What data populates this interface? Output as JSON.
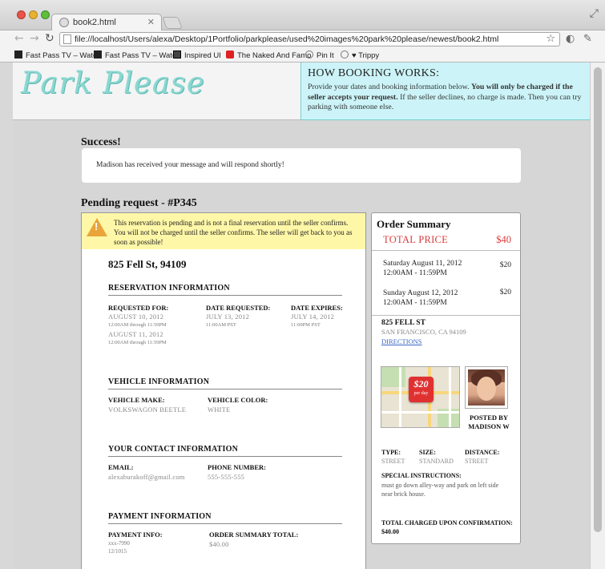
{
  "browser": {
    "tab_title": "book2.html",
    "url": "file://localhost/Users/alexa/Desktop/1Portfolio/parkplease/used%20images%20park%20please/newest/book2.html",
    "bookmarks": [
      "Fast Pass TV – Watch",
      "Fast Pass TV – Watch",
      "Inspired UI",
      "The Naked And Famo",
      "Pin It",
      "♥ Trippy"
    ]
  },
  "header": {
    "logo": "Park Please",
    "how_title": "HOW BOOKING WORKS:",
    "how_text_1": "Provide your dates and booking information below. ",
    "how_text_bold": "You will only be charged if the seller accepts your request.",
    "how_text_2": " If the seller declines, no charge is made. Then you can try parking with someone else."
  },
  "success": {
    "title": "Success!",
    "message": "Madison has received your message and will respond shortly!"
  },
  "pending": {
    "title": "Pending request - #P345",
    "warning": "This reservation is pending and is not a final reservation until the seller confirms. You will not be charged until the seller confirms. The seller will get back to you as soon as possible!",
    "address": "825 Fell St, 94109",
    "reservation": {
      "heading": "RESERVATION INFORMATION",
      "requested_for_label": "REQUESTED FOR:",
      "date1": "AUGUST 10, 2012",
      "time1": "12:00AM through 11:59PM",
      "date2": "AUGUST 11, 2012",
      "time2": "12:00AM through 11:59PM",
      "date_requested_label": "DATE REQUESTED:",
      "date_requested": "JULY 13, 2012",
      "date_requested_time": "11:00AM PST",
      "date_expires_label": "DATE EXPIRES:",
      "date_expires": "JULY 14, 2012",
      "date_expires_time": "11:00PM PST"
    },
    "vehicle": {
      "heading": "VEHICLE INFORMATION",
      "make_label": "VEHICLE MAKE:",
      "make": "VOLKSWAGON BEETLE",
      "color_label": "VEHICLE COLOR:",
      "color": "WHITE"
    },
    "contact": {
      "heading": "YOUR CONTACT INFORMATION",
      "email_label": "EMAIL:",
      "email": "alexaburakoff@gmail.com",
      "phone_label": "PHONE NUMBER:",
      "phone": "555-555-555"
    },
    "payment": {
      "heading": "PAYMENT INFORMATION",
      "info_label": "PAYMENT INFO:",
      "card": "xxx-7990",
      "expiry": "12/1015",
      "total_label": "ORDER SUMMARY TOTAL:",
      "total": "$40.00"
    }
  },
  "summary": {
    "title": "Order Summary",
    "total_label": "TOTAL PRICE",
    "total": "$40",
    "days": [
      {
        "date": "Saturday August 11, 2012",
        "time": "12:00AM - 11:59PM",
        "price": "$20"
      },
      {
        "date": "Sunday August 12, 2012",
        "time": "12:00AM - 11:59PM",
        "price": "$20"
      }
    ],
    "street": "825 FELL ST",
    "city": "SAN FRANCISCO, CA 94109",
    "directions": "DIRECTIONS",
    "price_tag": "$20",
    "price_tag_sub": "per day",
    "posted_by": "POSTED BY MADISON W",
    "type_label": "TYPE:",
    "type": "STREET",
    "size_label": "SIZE:",
    "size": "STANDARD",
    "distance_label": "DISTANCE:",
    "distance": "STREET",
    "instructions_label": "SPECIAL INSTRUCTIONS:",
    "instructions": "must go down alley-way and park on left side near brick house.",
    "charged": "TOTAL CHARGED UPON CONFIRMATION: $40.00"
  },
  "colors": {
    "accent_red": "#d93c3c",
    "info_box": "#ccf4f8",
    "warning_bg": "#fff7a8",
    "logo": "#8ad8d2"
  }
}
